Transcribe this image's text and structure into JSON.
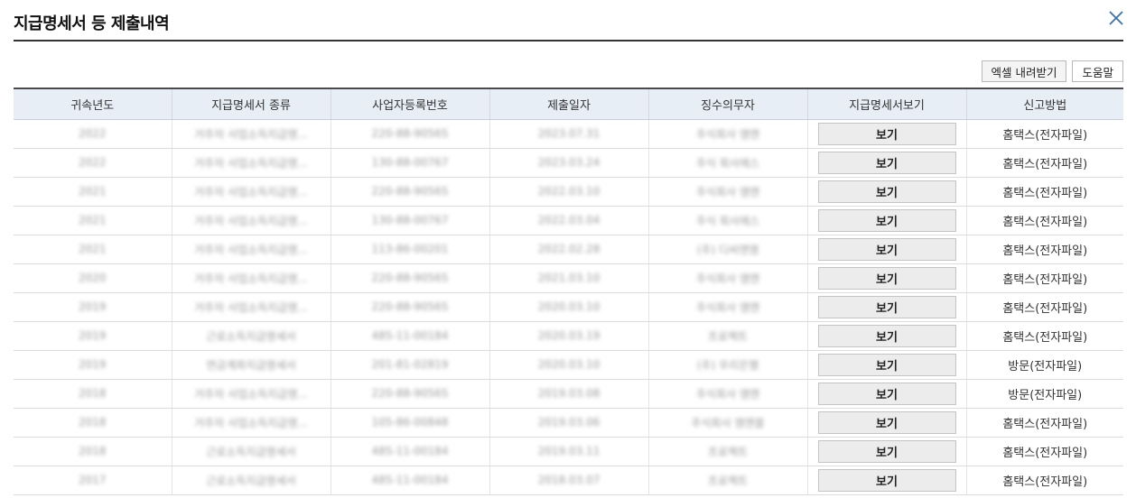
{
  "dialog": {
    "title": "지급명세서 등 제출내역"
  },
  "toolbar": {
    "excel_label": "엑셀 내려받기",
    "help_label": "도움말"
  },
  "table": {
    "columns": [
      "귀속년도",
      "지급명세서 종류",
      "사업자등록번호",
      "제출일자",
      "징수의무자",
      "지급명세서보기",
      "신고방법"
    ],
    "rows": [
      {
        "year": "2022",
        "type": "거주자 사업소득지급명...",
        "bizno": "220-88-90565",
        "date": "2023.07.31",
        "payer": "주식회사 엠엔",
        "view": "보기",
        "method": "홈택스(전자파일)"
      },
      {
        "year": "2022",
        "type": "거주자 사업소득지급명...",
        "bizno": "130-88-00767",
        "date": "2023.03.24",
        "payer": "주식 회사에스",
        "view": "보기",
        "method": "홈택스(전자파일)"
      },
      {
        "year": "2021",
        "type": "거주자 사업소득지급명...",
        "bizno": "220-88-90565",
        "date": "2022.03.10",
        "payer": "주식회사 엠엔",
        "view": "보기",
        "method": "홈택스(전자파일)"
      },
      {
        "year": "2021",
        "type": "거주자 사업소득지급명...",
        "bizno": "130-88-00767",
        "date": "2022.03.04",
        "payer": "주식 회사에스",
        "view": "보기",
        "method": "홈택스(전자파일)"
      },
      {
        "year": "2021",
        "type": "거주자 사업소득지급명...",
        "bizno": "113-86-00201",
        "date": "2022.02.28",
        "payer": "(주) 디씨엔엠",
        "view": "보기",
        "method": "홈택스(전자파일)"
      },
      {
        "year": "2020",
        "type": "거주자 사업소득지급명...",
        "bizno": "220-88-90565",
        "date": "2021.03.10",
        "payer": "주식회사 엠엔",
        "view": "보기",
        "method": "홈택스(전자파일)"
      },
      {
        "year": "2019",
        "type": "거주자 사업소득지급명...",
        "bizno": "220-88-90565",
        "date": "2020.03.10",
        "payer": "주식회사 엠엔",
        "view": "보기",
        "method": "홈택스(전자파일)"
      },
      {
        "year": "2019",
        "type": "근로소득지급명세서",
        "bizno": "485-11-00184",
        "date": "2020.03.19",
        "payer": "프로젝트",
        "view": "보기",
        "method": "홈택스(전자파일)"
      },
      {
        "year": "2019",
        "type": "연금계좌지급명세서",
        "bizno": "201-81-02819",
        "date": "2020.03.10",
        "payer": "(주) 우리은행",
        "view": "보기",
        "method": "방문(전자파일)"
      },
      {
        "year": "2018",
        "type": "거주자 사업소득지급명...",
        "bizno": "220-88-90565",
        "date": "2019.03.08",
        "payer": "주식회사 엠엔",
        "view": "보기",
        "method": "방문(전자파일)"
      },
      {
        "year": "2018",
        "type": "거주자 사업소득지급명...",
        "bizno": "105-86-00848",
        "date": "2019.03.06",
        "payer": "주식회사 엠엔블",
        "view": "보기",
        "method": "홈택스(전자파일)"
      },
      {
        "year": "2018",
        "type": "근로소득지급명세서",
        "bizno": "485-11-00184",
        "date": "2019.03.11",
        "payer": "프로젝트",
        "view": "보기",
        "method": "홈택스(전자파일)"
      },
      {
        "year": "2017",
        "type": "근로소득지급명세서",
        "bizno": "485-11-00184",
        "date": "2018.03.07",
        "payer": "프로젝트",
        "view": "보기",
        "method": "홈택스(전자파일)"
      }
    ]
  }
}
